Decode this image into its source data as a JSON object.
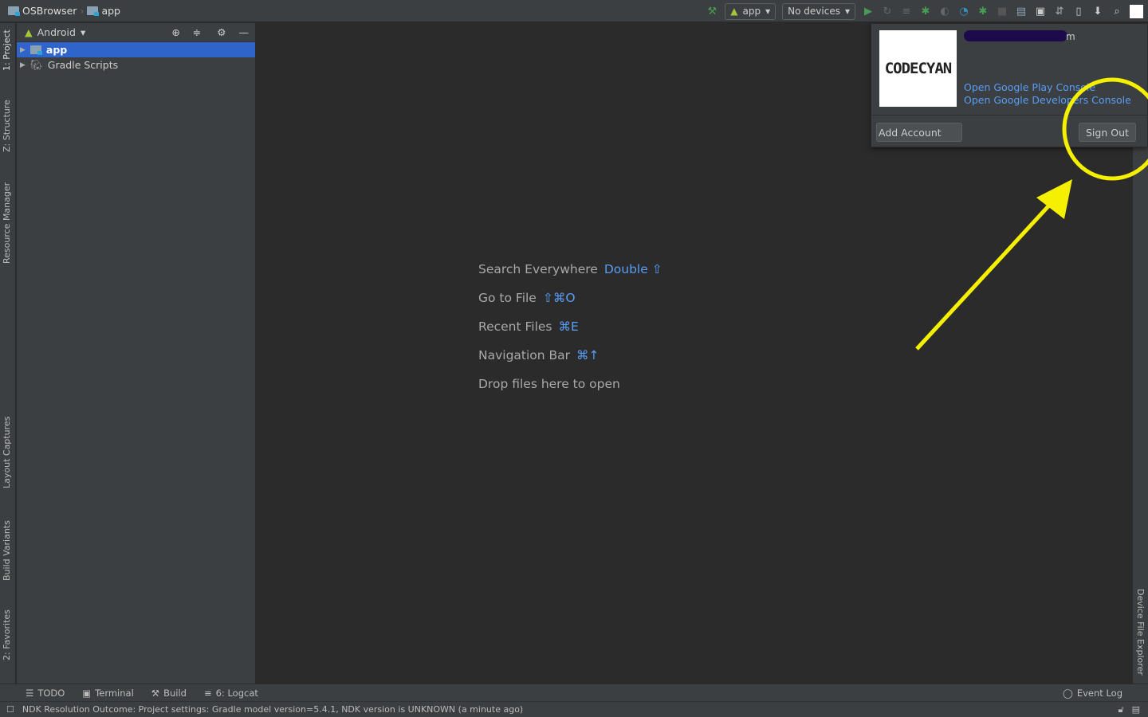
{
  "breadcrumb": {
    "project": "OSBrowser",
    "module": "app"
  },
  "toolbar": {
    "run_config": "app",
    "device": "No devices",
    "accent_run": "#499c54"
  },
  "left_tabs": [
    "1: Project",
    "Z: Structure",
    "Resource Manager",
    "Layout Captures",
    "Build Variants",
    "2: Favorites"
  ],
  "right_tabs": [
    "Device File Explorer"
  ],
  "project_panel": {
    "view": "Android",
    "items": [
      {
        "label": "app",
        "selected": true
      },
      {
        "label": "Gradle Scripts",
        "selected": false
      }
    ]
  },
  "hints": [
    {
      "label": "Search Everywhere",
      "key": "Double ⇧"
    },
    {
      "label": "Go to File",
      "key": "⇧⌘O"
    },
    {
      "label": "Recent Files",
      "key": "⌘E"
    },
    {
      "label": "Navigation Bar",
      "key": "⌘↑"
    },
    {
      "label": "Drop files here to open",
      "key": ""
    }
  ],
  "account_popup": {
    "logo": "CODECYAN",
    "email_visible_tail": "m",
    "links": [
      "Open Google Play Console",
      "Open Google Developers Console"
    ],
    "add_account": "Add Account",
    "sign_out": "Sign Out"
  },
  "bottom_tools": [
    "TODO",
    "Terminal",
    "Build",
    "6: Logcat"
  ],
  "event_log": "Event Log",
  "status_message": "NDK Resolution Outcome: Project settings: Gradle model version=5.4.1, NDK version is UNKNOWN (a minute ago)",
  "annotation_color": "#f5f000"
}
